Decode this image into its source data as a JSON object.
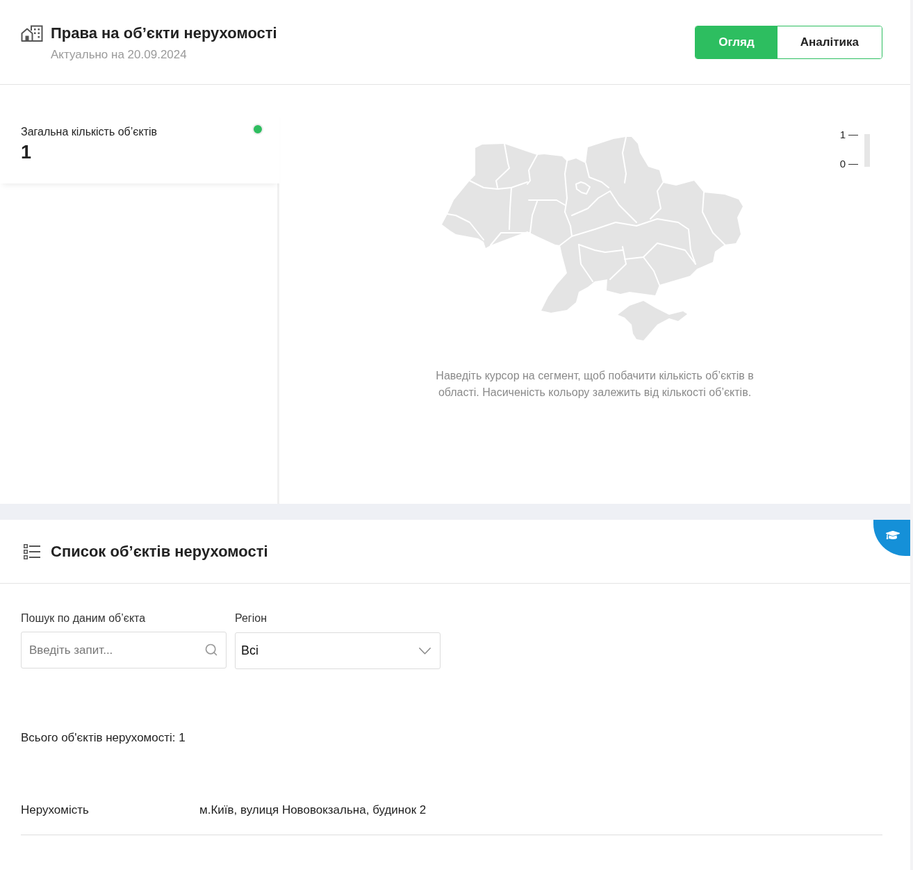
{
  "header": {
    "title": "Права на об’єкти нерухомості",
    "subtitle": "Актуально на 20.09.2024",
    "tabs": [
      {
        "label": "Огляд",
        "selected": true
      },
      {
        "label": "Аналітика",
        "selected": false
      }
    ]
  },
  "summary": {
    "label": "Загальна кількість об’єктів",
    "value": "1"
  },
  "map": {
    "legend": {
      "max": "1",
      "min": "0"
    },
    "hint": "Наведіть курсор на сегмент, щоб побачити кількість об’єктів в області. Насиченість кольору залежить від кількості об’єктів."
  },
  "list": {
    "title": "Список об’єктів нерухомості",
    "search": {
      "label": "Пошук по даним об’єкта",
      "placeholder": "Введіть запит..."
    },
    "region": {
      "label": "Регіон",
      "value": "Всі"
    },
    "total": "Всього об'єктів нерухомості: 1",
    "rows": [
      {
        "label": "Нерухомість",
        "value": "м.Київ, вулиця Нововокзальна, будинок 2"
      }
    ]
  }
}
